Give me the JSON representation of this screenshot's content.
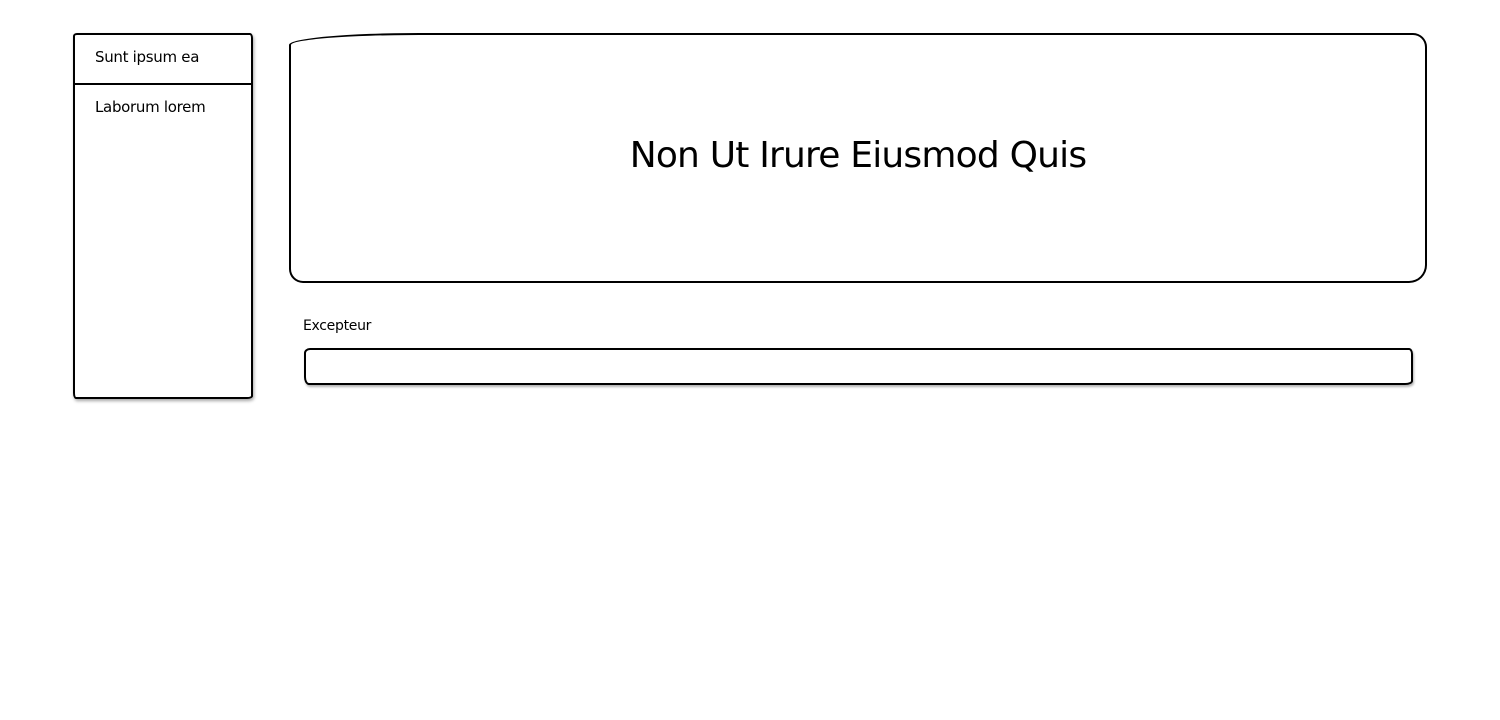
{
  "sidebar": {
    "items": [
      {
        "label": "Sunt ipsum ea"
      },
      {
        "label": "Laborum lorem"
      }
    ]
  },
  "hero": {
    "title": "Non Ut Irure Eiusmod Quis"
  },
  "form": {
    "field_label": "Excepteur",
    "field_value": ""
  }
}
